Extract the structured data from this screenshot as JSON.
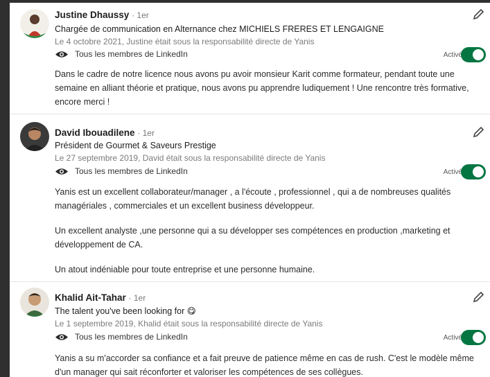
{
  "recommendations": [
    {
      "name": "Justine Dhaussy",
      "degree": "· 1er",
      "headline": "Chargée de communication en Alternance chez MICHIELS FRERES ET LENGAIGNE",
      "relation": "Le 4 octobre 2021, Justine était sous la responsabilité directe de Yanis",
      "visibility": "Tous les membres de LinkedIn",
      "status": "Activé",
      "paragraphs": [
        "Dans le cadre de notre licence nous avons pu avoir monsieur Karit comme formateur, pendant toute une semaine en alliant théorie et pratique, nous avons pu apprendre ludiquement ! Une rencontre très formative, encore merci !"
      ]
    },
    {
      "name": "David Ibouadilene",
      "degree": "· 1er",
      "headline": "Président de Gourmet & Saveurs Prestige",
      "relation": "Le 27 septembre 2019, David était sous la responsabilité directe de Yanis",
      "visibility": "Tous les membres de LinkedIn",
      "status": "Activé",
      "paragraphs": [
        "Yanis est un excellent collaborateur/manager , a l'écoute , professionnel , qui a de nombreuses qualités managériales , commerciales et un excellent business développeur.",
        "Un excellent analyste ,une personne qui a su développer ses compétences en production ,marketing et développement de CA.",
        "Un atout indéniable pour toute entreprise et une personne humaine."
      ]
    },
    {
      "name": "Khalid Ait-Tahar",
      "degree": "· 1er",
      "headline": "The talent you've been looking for 😋",
      "relation": "Le 1 septembre 2019, Khalid était sous la responsabilité directe de Yanis",
      "visibility": "Tous les membres de LinkedIn",
      "status": "Activé",
      "paragraphs": [
        "Yanis a su m'accorder sa confiance et a fait preuve de patience même en cas de rush. C'est le modèle même d'un manager qui sait réconforter et valoriser les compétences de ses collègues."
      ]
    }
  ],
  "icons": {
    "visibility": "eye-icon",
    "edit": "pencil-icon"
  },
  "colors": {
    "toggle_on": "#057642"
  }
}
